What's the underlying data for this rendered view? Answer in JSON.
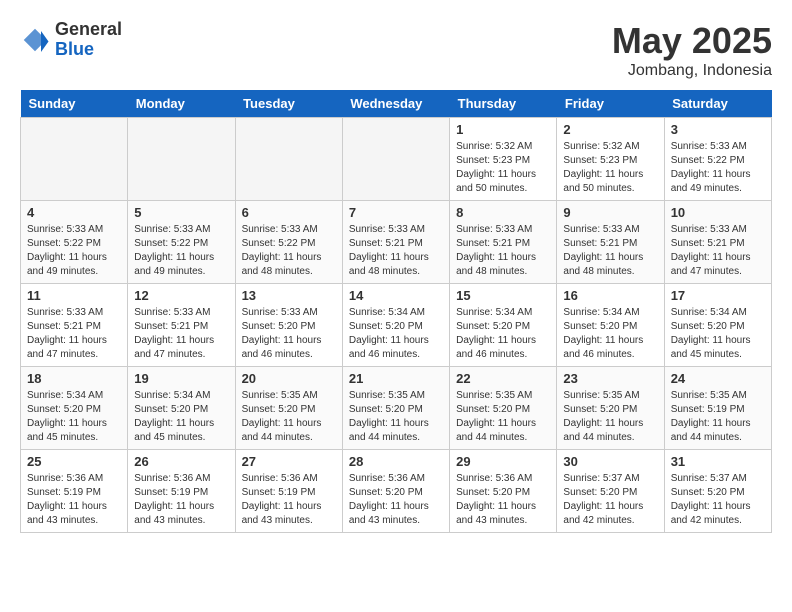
{
  "header": {
    "logo_general": "General",
    "logo_blue": "Blue",
    "month_title": "May 2025",
    "location": "Jombang, Indonesia"
  },
  "weekdays": [
    "Sunday",
    "Monday",
    "Tuesday",
    "Wednesday",
    "Thursday",
    "Friday",
    "Saturday"
  ],
  "weeks": [
    [
      {
        "day": "",
        "empty": true
      },
      {
        "day": "",
        "empty": true
      },
      {
        "day": "",
        "empty": true
      },
      {
        "day": "",
        "empty": true
      },
      {
        "day": "1",
        "sunrise": "Sunrise: 5:32 AM",
        "sunset": "Sunset: 5:23 PM",
        "daylight": "Daylight: 11 hours and 50 minutes."
      },
      {
        "day": "2",
        "sunrise": "Sunrise: 5:32 AM",
        "sunset": "Sunset: 5:23 PM",
        "daylight": "Daylight: 11 hours and 50 minutes."
      },
      {
        "day": "3",
        "sunrise": "Sunrise: 5:33 AM",
        "sunset": "Sunset: 5:22 PM",
        "daylight": "Daylight: 11 hours and 49 minutes."
      }
    ],
    [
      {
        "day": "4",
        "sunrise": "Sunrise: 5:33 AM",
        "sunset": "Sunset: 5:22 PM",
        "daylight": "Daylight: 11 hours and 49 minutes."
      },
      {
        "day": "5",
        "sunrise": "Sunrise: 5:33 AM",
        "sunset": "Sunset: 5:22 PM",
        "daylight": "Daylight: 11 hours and 49 minutes."
      },
      {
        "day": "6",
        "sunrise": "Sunrise: 5:33 AM",
        "sunset": "Sunset: 5:22 PM",
        "daylight": "Daylight: 11 hours and 48 minutes."
      },
      {
        "day": "7",
        "sunrise": "Sunrise: 5:33 AM",
        "sunset": "Sunset: 5:21 PM",
        "daylight": "Daylight: 11 hours and 48 minutes."
      },
      {
        "day": "8",
        "sunrise": "Sunrise: 5:33 AM",
        "sunset": "Sunset: 5:21 PM",
        "daylight": "Daylight: 11 hours and 48 minutes."
      },
      {
        "day": "9",
        "sunrise": "Sunrise: 5:33 AM",
        "sunset": "Sunset: 5:21 PM",
        "daylight": "Daylight: 11 hours and 48 minutes."
      },
      {
        "day": "10",
        "sunrise": "Sunrise: 5:33 AM",
        "sunset": "Sunset: 5:21 PM",
        "daylight": "Daylight: 11 hours and 47 minutes."
      }
    ],
    [
      {
        "day": "11",
        "sunrise": "Sunrise: 5:33 AM",
        "sunset": "Sunset: 5:21 PM",
        "daylight": "Daylight: 11 hours and 47 minutes."
      },
      {
        "day": "12",
        "sunrise": "Sunrise: 5:33 AM",
        "sunset": "Sunset: 5:21 PM",
        "daylight": "Daylight: 11 hours and 47 minutes."
      },
      {
        "day": "13",
        "sunrise": "Sunrise: 5:33 AM",
        "sunset": "Sunset: 5:20 PM",
        "daylight": "Daylight: 11 hours and 46 minutes."
      },
      {
        "day": "14",
        "sunrise": "Sunrise: 5:34 AM",
        "sunset": "Sunset: 5:20 PM",
        "daylight": "Daylight: 11 hours and 46 minutes."
      },
      {
        "day": "15",
        "sunrise": "Sunrise: 5:34 AM",
        "sunset": "Sunset: 5:20 PM",
        "daylight": "Daylight: 11 hours and 46 minutes."
      },
      {
        "day": "16",
        "sunrise": "Sunrise: 5:34 AM",
        "sunset": "Sunset: 5:20 PM",
        "daylight": "Daylight: 11 hours and 46 minutes."
      },
      {
        "day": "17",
        "sunrise": "Sunrise: 5:34 AM",
        "sunset": "Sunset: 5:20 PM",
        "daylight": "Daylight: 11 hours and 45 minutes."
      }
    ],
    [
      {
        "day": "18",
        "sunrise": "Sunrise: 5:34 AM",
        "sunset": "Sunset: 5:20 PM",
        "daylight": "Daylight: 11 hours and 45 minutes."
      },
      {
        "day": "19",
        "sunrise": "Sunrise: 5:34 AM",
        "sunset": "Sunset: 5:20 PM",
        "daylight": "Daylight: 11 hours and 45 minutes."
      },
      {
        "day": "20",
        "sunrise": "Sunrise: 5:35 AM",
        "sunset": "Sunset: 5:20 PM",
        "daylight": "Daylight: 11 hours and 44 minutes."
      },
      {
        "day": "21",
        "sunrise": "Sunrise: 5:35 AM",
        "sunset": "Sunset: 5:20 PM",
        "daylight": "Daylight: 11 hours and 44 minutes."
      },
      {
        "day": "22",
        "sunrise": "Sunrise: 5:35 AM",
        "sunset": "Sunset: 5:20 PM",
        "daylight": "Daylight: 11 hours and 44 minutes."
      },
      {
        "day": "23",
        "sunrise": "Sunrise: 5:35 AM",
        "sunset": "Sunset: 5:20 PM",
        "daylight": "Daylight: 11 hours and 44 minutes."
      },
      {
        "day": "24",
        "sunrise": "Sunrise: 5:35 AM",
        "sunset": "Sunset: 5:19 PM",
        "daylight": "Daylight: 11 hours and 44 minutes."
      }
    ],
    [
      {
        "day": "25",
        "sunrise": "Sunrise: 5:36 AM",
        "sunset": "Sunset: 5:19 PM",
        "daylight": "Daylight: 11 hours and 43 minutes."
      },
      {
        "day": "26",
        "sunrise": "Sunrise: 5:36 AM",
        "sunset": "Sunset: 5:19 PM",
        "daylight": "Daylight: 11 hours and 43 minutes."
      },
      {
        "day": "27",
        "sunrise": "Sunrise: 5:36 AM",
        "sunset": "Sunset: 5:19 PM",
        "daylight": "Daylight: 11 hours and 43 minutes."
      },
      {
        "day": "28",
        "sunrise": "Sunrise: 5:36 AM",
        "sunset": "Sunset: 5:20 PM",
        "daylight": "Daylight: 11 hours and 43 minutes."
      },
      {
        "day": "29",
        "sunrise": "Sunrise: 5:36 AM",
        "sunset": "Sunset: 5:20 PM",
        "daylight": "Daylight: 11 hours and 43 minutes."
      },
      {
        "day": "30",
        "sunrise": "Sunrise: 5:37 AM",
        "sunset": "Sunset: 5:20 PM",
        "daylight": "Daylight: 11 hours and 42 minutes."
      },
      {
        "day": "31",
        "sunrise": "Sunrise: 5:37 AM",
        "sunset": "Sunset: 5:20 PM",
        "daylight": "Daylight: 11 hours and 42 minutes."
      }
    ]
  ]
}
